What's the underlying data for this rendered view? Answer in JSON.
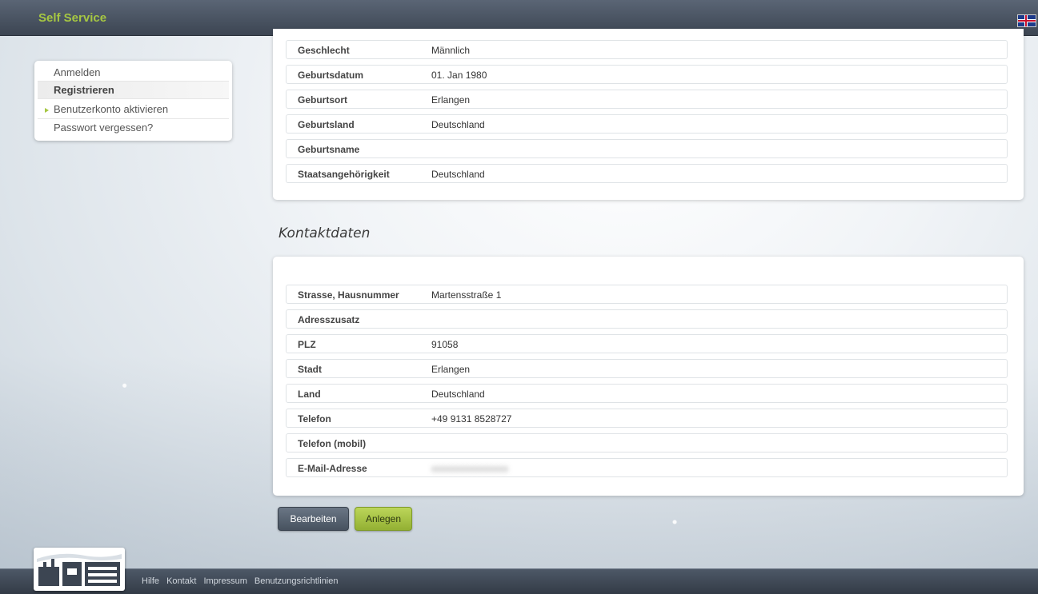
{
  "header": {
    "title": "Self Service",
    "language_icon": "uk-flag-icon"
  },
  "sidebar": {
    "items": [
      {
        "label": "Anmelden"
      },
      {
        "label": "Registrieren"
      },
      {
        "label": "Benutzerkonto aktivieren"
      },
      {
        "label": "Passwort vergessen?"
      }
    ]
  },
  "personal": {
    "rows": [
      {
        "label": "Geschlecht",
        "value": "Männlich"
      },
      {
        "label": "Geburtsdatum",
        "value": "01. Jan 1980"
      },
      {
        "label": "Geburtsort",
        "value": "Erlangen"
      },
      {
        "label": "Geburtsland",
        "value": "Deutschland"
      },
      {
        "label": "Geburtsname",
        "value": ""
      },
      {
        "label": "Staatsangehörigkeit",
        "value": "Deutschland"
      }
    ]
  },
  "contact": {
    "title": "Kontaktdaten",
    "rows": [
      {
        "label": "Strasse, Hausnummer",
        "value": "Martensstraße 1"
      },
      {
        "label": "Adresszusatz",
        "value": ""
      },
      {
        "label": "PLZ",
        "value": "91058"
      },
      {
        "label": "Stadt",
        "value": "Erlangen"
      },
      {
        "label": "Land",
        "value": "Deutschland"
      },
      {
        "label": "Telefon",
        "value": "+49 9131 8528727"
      },
      {
        "label": "Telefon (mobil)",
        "value": ""
      },
      {
        "label": "E-Mail-Adresse",
        "value": "xxxxxxxxxxxxxxxx"
      }
    ]
  },
  "buttons": {
    "edit": "Bearbeiten",
    "create": "Anlegen"
  },
  "footer": {
    "links": [
      "Hilfe",
      "Kontakt",
      "Impressum",
      "Benutzungsrichtlinien"
    ]
  },
  "colors": {
    "accent": "#a6c742",
    "topbar": "#3c4552"
  }
}
